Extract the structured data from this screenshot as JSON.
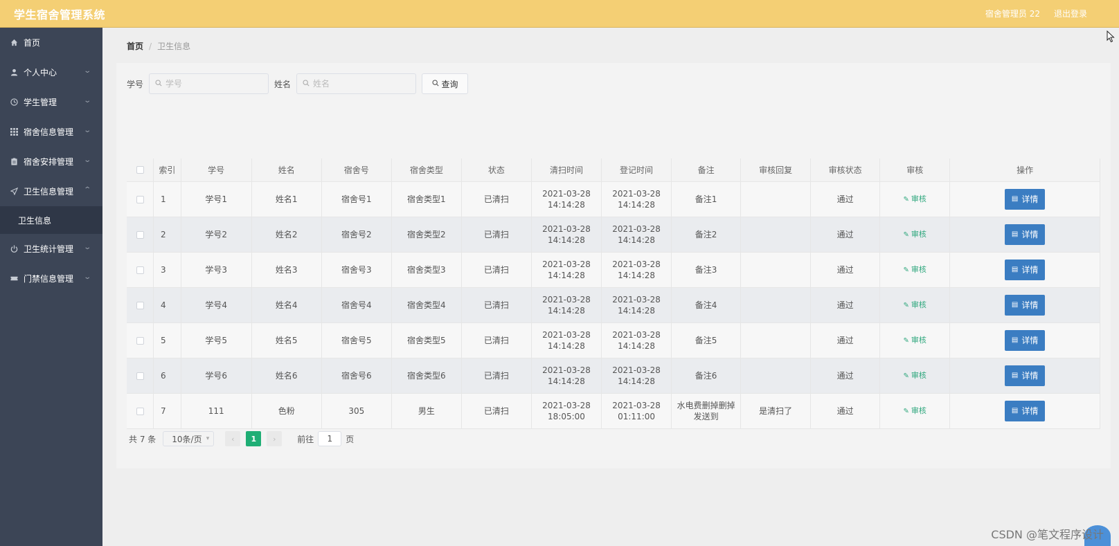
{
  "header": {
    "title": "学生宿舍管理系统",
    "user": "宿舍管理员 22",
    "logout": "退出登录"
  },
  "sidebar": {
    "items": [
      {
        "label": "首页",
        "icon": "home-icon"
      },
      {
        "label": "个人中心",
        "icon": "user-icon"
      },
      {
        "label": "学生管理",
        "icon": "clock-icon"
      },
      {
        "label": "宿舍信息管理",
        "icon": "grid-icon"
      },
      {
        "label": "宿舍安排管理",
        "icon": "clipboard-icon"
      },
      {
        "label": "卫生信息管理",
        "icon": "send-icon"
      },
      {
        "label": "卫生统计管理",
        "icon": "power-icon"
      },
      {
        "label": "门禁信息管理",
        "icon": "ticket-icon"
      }
    ],
    "sub_item": "卫生信息"
  },
  "breadcrumb": {
    "home": "首页",
    "separator": "/",
    "current": "卫生信息"
  },
  "search": {
    "student_no_label": "学号",
    "student_no_placeholder": "学号",
    "name_label": "姓名",
    "name_placeholder": "姓名",
    "query_button": "查询"
  },
  "table": {
    "headers": [
      "索引",
      "学号",
      "姓名",
      "宿舍号",
      "宿舍类型",
      "状态",
      "清扫时间",
      "登记时间",
      "备注",
      "审核回复",
      "审核状态",
      "审核",
      "操作"
    ],
    "audit_link": "审核",
    "detail_button": "详情",
    "rows": [
      {
        "index": "1",
        "no": "学号1",
        "name": "姓名1",
        "room": "宿舍号1",
        "type": "宿舍类型1",
        "status": "已清扫",
        "clean_time": "2021-03-28 14:14:28",
        "reg_time": "2021-03-28 14:14:28",
        "remark": "备注1",
        "reply": "",
        "audit_status": "通过"
      },
      {
        "index": "2",
        "no": "学号2",
        "name": "姓名2",
        "room": "宿舍号2",
        "type": "宿舍类型2",
        "status": "已清扫",
        "clean_time": "2021-03-28 14:14:28",
        "reg_time": "2021-03-28 14:14:28",
        "remark": "备注2",
        "reply": "",
        "audit_status": "通过"
      },
      {
        "index": "3",
        "no": "学号3",
        "name": "姓名3",
        "room": "宿舍号3",
        "type": "宿舍类型3",
        "status": "已清扫",
        "clean_time": "2021-03-28 14:14:28",
        "reg_time": "2021-03-28 14:14:28",
        "remark": "备注3",
        "reply": "",
        "audit_status": "通过"
      },
      {
        "index": "4",
        "no": "学号4",
        "name": "姓名4",
        "room": "宿舍号4",
        "type": "宿舍类型4",
        "status": "已清扫",
        "clean_time": "2021-03-28 14:14:28",
        "reg_time": "2021-03-28 14:14:28",
        "remark": "备注4",
        "reply": "",
        "audit_status": "通过"
      },
      {
        "index": "5",
        "no": "学号5",
        "name": "姓名5",
        "room": "宿舍号5",
        "type": "宿舍类型5",
        "status": "已清扫",
        "clean_time": "2021-03-28 14:14:28",
        "reg_time": "2021-03-28 14:14:28",
        "remark": "备注5",
        "reply": "",
        "audit_status": "通过"
      },
      {
        "index": "6",
        "no": "学号6",
        "name": "姓名6",
        "room": "宿舍号6",
        "type": "宿舍类型6",
        "status": "已清扫",
        "clean_time": "2021-03-28 14:14:28",
        "reg_time": "2021-03-28 14:14:28",
        "remark": "备注6",
        "reply": "",
        "audit_status": "通过"
      },
      {
        "index": "7",
        "no": "111",
        "name": "色粉",
        "room": "305",
        "type": "男生",
        "status": "已清扫",
        "clean_time": "2021-03-28 18:05:00",
        "reg_time": "2021-03-28 01:11:00",
        "remark": "水电费删掉删掉发送到",
        "reply": "是清扫了",
        "audit_status": "通过"
      }
    ]
  },
  "pagination": {
    "total": "共 7 条",
    "page_size": "10条/页",
    "current_page": "1",
    "goto_label": "前往",
    "goto_value": "1",
    "page_suffix": "页"
  },
  "watermark": "CSDN @笔文程序设计",
  "colors": {
    "header_bg": "#f4cf74",
    "sidebar_bg": "#3c4556",
    "detail_button": "#3b7dc2",
    "audit_link": "#2fa77d",
    "active_page": "#1fae75"
  }
}
